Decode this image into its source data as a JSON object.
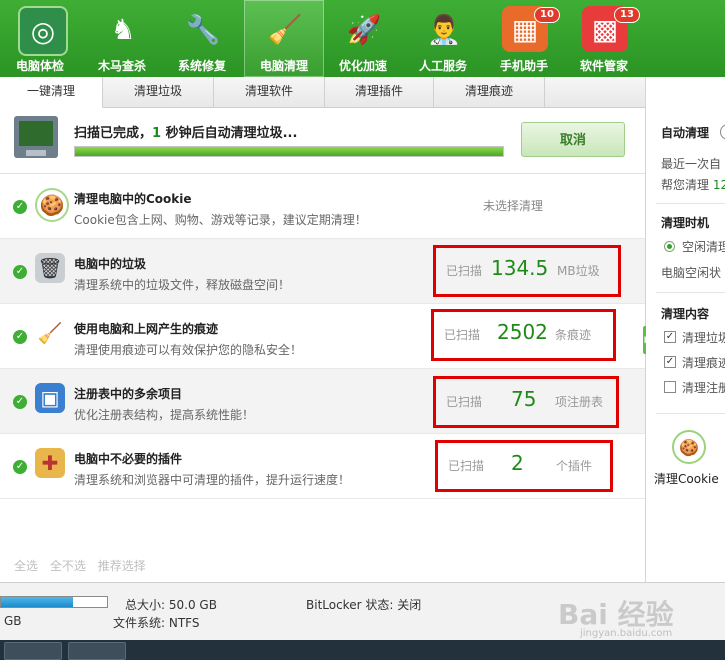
{
  "toolbar": {
    "items": [
      {
        "label": "电脑体检",
        "icon": "radar-icon",
        "bg": "#2f8f4a"
      },
      {
        "label": "木马查杀",
        "icon": "horse-shield-icon",
        "bg": "#2b9424"
      },
      {
        "label": "系统修复",
        "icon": "wrench-icon",
        "bg": "#2b9424"
      },
      {
        "label": "电脑清理",
        "icon": "broom-icon",
        "bg": "#f1c232"
      },
      {
        "label": "优化加速",
        "icon": "rocket-icon",
        "bg": "#2b9424"
      },
      {
        "label": "人工服务",
        "icon": "doctor-icon",
        "bg": "#2b9424"
      },
      {
        "label": "手机助手",
        "icon": "phone-apps-icon",
        "bg": "#e96b2c",
        "badge": "10"
      },
      {
        "label": "软件管家",
        "icon": "app-grid-icon",
        "bg": "#e83b3b",
        "badge": "13"
      }
    ]
  },
  "tabs": [
    "一键清理",
    "清理垃圾",
    "清理软件",
    "清理插件",
    "清理痕迹"
  ],
  "scan": {
    "prefix": "扫描已完成，",
    "count": "1",
    "suffix": " 秒钟后自动清理垃圾...",
    "progress": 1.0,
    "cancel_label": "取消"
  },
  "rows": [
    {
      "title": "清理电脑中的Cookie",
      "desc": "Cookie包含上网、购物、游戏等记录，建议定期清理！",
      "icon": "cookie-icon",
      "status": "未选择清理"
    },
    {
      "title": "电脑中的垃圾",
      "desc": "清理系统中的垃圾文件，释放磁盘空间！",
      "icon": "trash-can-icon",
      "scan_label": "已扫描",
      "value": "134.5",
      "unit": "MB垃圾"
    },
    {
      "title": "使用电脑和上网产生的痕迹",
      "desc": "清理使用痕迹可以有效保护您的隐私安全！",
      "icon": "broom-icon",
      "scan_label": "已扫描",
      "value": "2502",
      "unit": "条痕迹"
    },
    {
      "title": "注册表中的多余项目",
      "desc": "优化注册表结构，提高系统性能！",
      "icon": "registry-cubes-icon",
      "scan_label": "已扫描",
      "value": "75",
      "unit": "项注册表"
    },
    {
      "title": "电脑中不必要的插件",
      "desc": "清理系统和浏览器中可清理的插件，提升运行速度！",
      "icon": "plugin-puzzle-icon",
      "scan_label": "已扫描",
      "value": "2",
      "unit": "个插件"
    }
  ],
  "bottom_links": [
    "全选",
    "全不选",
    "推荐选择"
  ],
  "right_panel": {
    "auto_clean_title": "自动清理",
    "recent_line": "最近一次自",
    "help_line_prefix": "帮您清理",
    "help_line_value": "12",
    "timing_title": "清理时机",
    "timing_option": "空闲清理",
    "timing_desc": "电脑空闲状",
    "content_title": "清理内容",
    "content_items": [
      {
        "label": "清理垃圾",
        "checked": true
      },
      {
        "label": "清理痕迹",
        "checked": true
      },
      {
        "label": "清理注册",
        "checked": false
      }
    ],
    "cookie_label": "清理Cookie"
  },
  "statusbar": {
    "total_label": "总大小: 50.0 GB",
    "fs_label": "文件系统: NTFS",
    "bitlocker_label": "BitLocker 状态: 关闭",
    "left_gb": "GB",
    "disk_fill": 0.68
  },
  "watermark": {
    "main": "Bai 经验",
    "sub": "jingyan.baidu.com"
  }
}
